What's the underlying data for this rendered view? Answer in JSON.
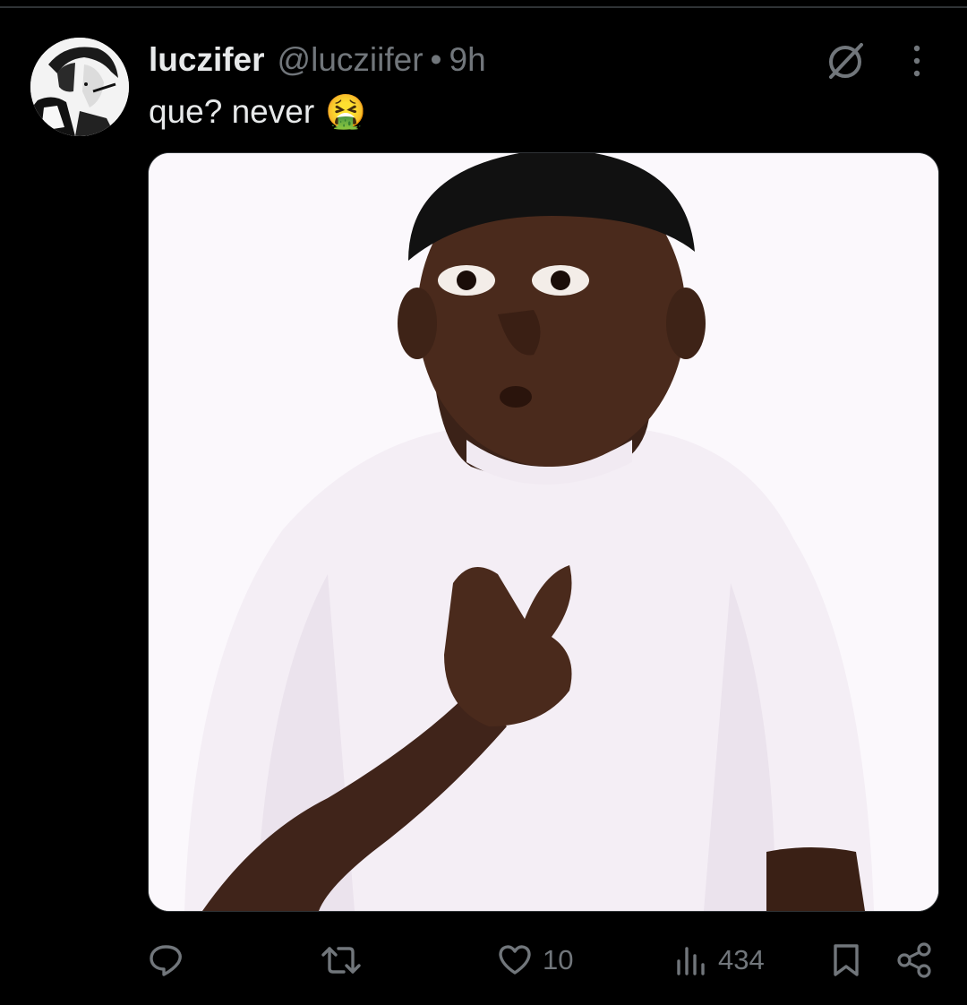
{
  "tweet": {
    "display_name": "luczifer",
    "handle": "@lucziifer",
    "separator": "•",
    "time": "9h",
    "text": "que? never",
    "emoji": "🤮"
  },
  "icons": {
    "header": [
      "grok-icon",
      "more-icon"
    ],
    "actions": [
      "reply-icon",
      "retweet-icon",
      "like-icon",
      "views-icon",
      "bookmark-icon",
      "share-icon"
    ]
  },
  "stats": {
    "reply_count": "",
    "retweet_count": "",
    "like_count": "10",
    "view_count": "434"
  },
  "colors": {
    "background": "#000000",
    "text_primary": "#e7e9ea",
    "text_secondary": "#71767b",
    "divider": "#2f3336"
  }
}
